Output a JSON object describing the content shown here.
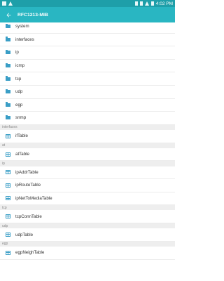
{
  "status_bar": {
    "time": "4:02 PM"
  },
  "app_bar": {
    "title": "RFC1213-MIB",
    "back_icon": "arrow-back-icon"
  },
  "folders": [
    {
      "label": "system"
    },
    {
      "label": "interfaces"
    },
    {
      "label": "ip"
    },
    {
      "label": "icmp"
    },
    {
      "label": "tcp"
    },
    {
      "label": "udp"
    },
    {
      "label": "egp"
    },
    {
      "label": "snmp"
    }
  ],
  "sections": [
    {
      "header": "interfaces",
      "items": [
        {
          "label": "ifTable"
        }
      ]
    },
    {
      "header": "at",
      "items": [
        {
          "label": "atTable"
        }
      ]
    },
    {
      "header": "ip",
      "items": [
        {
          "label": "ipAddrTable"
        },
        {
          "label": "ipRouteTable"
        },
        {
          "label": "ipNetToMediaTable"
        }
      ]
    },
    {
      "header": "tcp",
      "items": [
        {
          "label": "tcpConnTable"
        }
      ]
    },
    {
      "header": "udp",
      "items": [
        {
          "label": "udpTable"
        }
      ]
    },
    {
      "header": "egp",
      "items": [
        {
          "label": "egpNeighTable"
        }
      ]
    }
  ],
  "colors": {
    "status_bar": "#1e9fa9",
    "app_bar": "#29b6c2",
    "icon": "#3a9ec6",
    "section_bg": "#eeeeee"
  }
}
